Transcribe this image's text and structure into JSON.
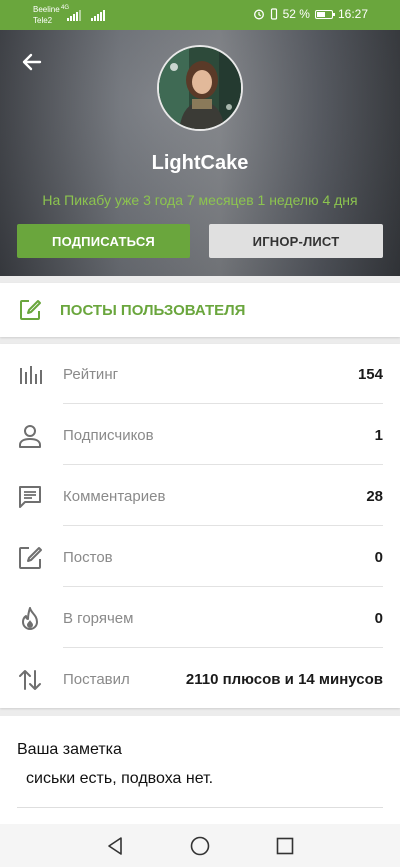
{
  "status_bar": {
    "carrier_1": "Beeline",
    "carrier_2": "Tele2",
    "network": "4G",
    "battery": "52 %",
    "time": "16:27"
  },
  "profile": {
    "username": "LightCake",
    "since": "На Пикабу уже 3 года 7 месяцев 1 неделю 4 дня",
    "subscribe_label": "ПОДПИСАТЬСЯ",
    "ignore_label": "ИГНОР-ЛИСТ"
  },
  "posts_link": {
    "label": "ПОСТЫ ПОЛЬЗОВАТЕЛЯ",
    "icon": "edit-icon"
  },
  "stats": [
    {
      "label": "Рейтинг",
      "value": "154",
      "icon": "bar-chart-icon"
    },
    {
      "label": "Подписчиков",
      "value": "1",
      "icon": "person-icon"
    },
    {
      "label": "Комментариев",
      "value": "28",
      "icon": "comment-icon"
    },
    {
      "label": "Постов",
      "value": "0",
      "icon": "edit-icon"
    },
    {
      "label": "В горячем",
      "value": "0",
      "icon": "fire-icon"
    },
    {
      "label": "Поставил",
      "value": "2110 плюсов и 14 минусов",
      "icon": "sort-arrows-icon"
    }
  ],
  "note": {
    "title": "Ваша заметка",
    "text": "сиськи есть, подвоха нет."
  },
  "colors": {
    "accent": "#6aa63d",
    "accent_light": "#8cc44f",
    "header_bg": "#5e6269"
  }
}
